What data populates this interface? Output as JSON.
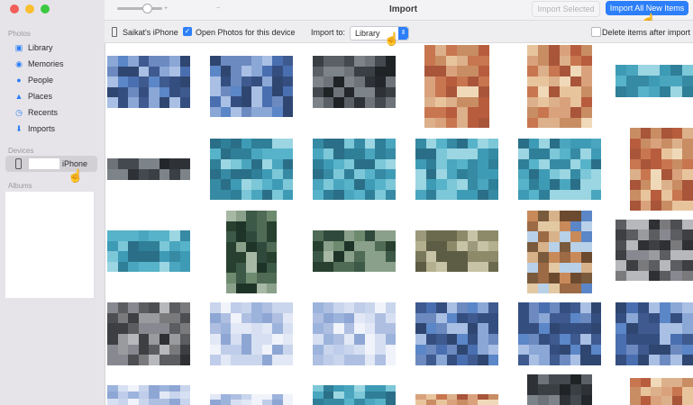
{
  "window": {
    "title": "Import"
  },
  "sidebar": {
    "photos_title": "Photos",
    "items": [
      {
        "label": "Library",
        "icon": "photo-library-icon"
      },
      {
        "label": "Memories",
        "icon": "memories-icon"
      },
      {
        "label": "People",
        "icon": "people-icon"
      },
      {
        "label": "Places",
        "icon": "places-icon"
      },
      {
        "label": "Recents",
        "icon": "recents-icon"
      },
      {
        "label": "Imports",
        "icon": "imports-icon"
      }
    ],
    "devices_title": "Devices",
    "device_label": "iPhone",
    "albums_title": "Albums"
  },
  "titlebar": {
    "import_selected": "Import Selected",
    "import_all": "Import All New Items"
  },
  "toolbar": {
    "device_name": "Saikat's iPhone",
    "open_photos_label": "Open Photos for this device",
    "import_to_label": "Import to:",
    "import_to_value": "Library",
    "delete_after_label": "Delete items after import"
  },
  "colors": {
    "accent": "#2d7ff9",
    "sidebar_bg": "#e6e4e8"
  }
}
